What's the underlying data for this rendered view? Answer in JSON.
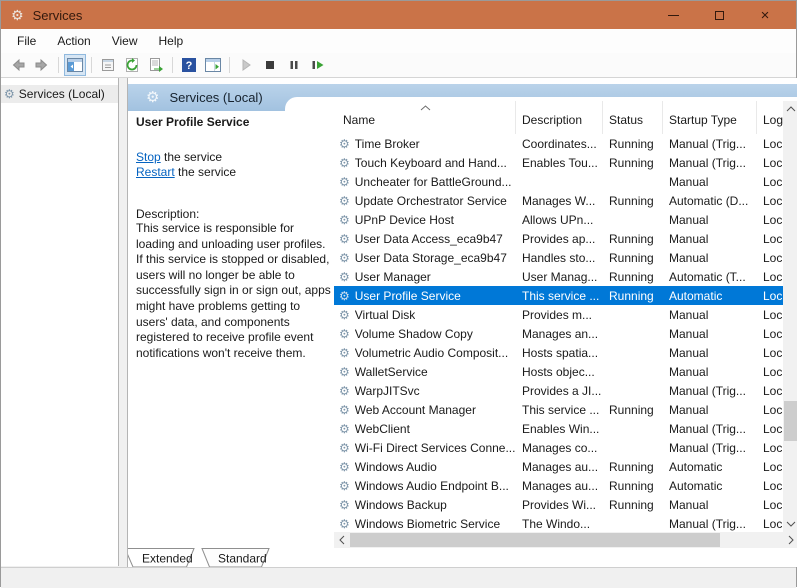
{
  "window": {
    "title": "Services"
  },
  "window_controls": {
    "minimize": "minimize",
    "maximize": "maximize",
    "close": "close"
  },
  "menu": {
    "items": [
      "File",
      "Action",
      "View",
      "Help"
    ]
  },
  "toolbar": {
    "icons": [
      "back",
      "forward",
      "show-console-tree",
      "properties",
      "refresh",
      "export-list",
      "help",
      "show-action-pane",
      "start-service",
      "stop-service",
      "pause-service",
      "restart-service"
    ]
  },
  "tree": {
    "root_label": "Services (Local)"
  },
  "detail_panel": {
    "header": "Services (Local)",
    "service_title": "User Profile Service",
    "links": [
      {
        "link": "Stop",
        "rest": " the service"
      },
      {
        "link": "Restart",
        "rest": " the service"
      }
    ],
    "description_label": "Description:",
    "description": "This service is responsible for loading and unloading user profiles. If this service is stopped or disabled, users will no longer be able to successfully sign in or sign out, apps might have problems getting to users' data, and components registered to receive profile event notifications won't receive them."
  },
  "services_list": {
    "columns": [
      "Name",
      "Description",
      "Status",
      "Startup Type",
      "Log"
    ],
    "sort_column": "Name",
    "rows": [
      {
        "name": "Time Broker",
        "description": "Coordinates...",
        "status": "Running",
        "startup_type": "Manual (Trig...",
        "log_on_as": "Loc",
        "selected": false
      },
      {
        "name": "Touch Keyboard and Hand...",
        "description": "Enables Tou...",
        "status": "Running",
        "startup_type": "Manual (Trig...",
        "log_on_as": "Loc",
        "selected": false
      },
      {
        "name": "Uncheater for BattleGround...",
        "description": "",
        "status": "",
        "startup_type": "Manual",
        "log_on_as": "Loc",
        "selected": false
      },
      {
        "name": "Update Orchestrator Service",
        "description": "Manages W...",
        "status": "Running",
        "startup_type": "Automatic (D...",
        "log_on_as": "Loc",
        "selected": false
      },
      {
        "name": "UPnP Device Host",
        "description": "Allows UPn...",
        "status": "",
        "startup_type": "Manual",
        "log_on_as": "Loc",
        "selected": false
      },
      {
        "name": "User Data Access_eca9b47",
        "description": "Provides ap...",
        "status": "Running",
        "startup_type": "Manual",
        "log_on_as": "Loc",
        "selected": false
      },
      {
        "name": "User Data Storage_eca9b47",
        "description": "Handles sto...",
        "status": "Running",
        "startup_type": "Manual",
        "log_on_as": "Loc",
        "selected": false
      },
      {
        "name": "User Manager",
        "description": "User Manag...",
        "status": "Running",
        "startup_type": "Automatic (T...",
        "log_on_as": "Loc",
        "selected": false
      },
      {
        "name": "User Profile Service",
        "description": "This service ...",
        "status": "Running",
        "startup_type": "Automatic",
        "log_on_as": "Loc",
        "selected": true
      },
      {
        "name": "Virtual Disk",
        "description": "Provides m...",
        "status": "",
        "startup_type": "Manual",
        "log_on_as": "Loc",
        "selected": false
      },
      {
        "name": "Volume Shadow Copy",
        "description": "Manages an...",
        "status": "",
        "startup_type": "Manual",
        "log_on_as": "Loc",
        "selected": false
      },
      {
        "name": "Volumetric Audio Composit...",
        "description": "Hosts spatia...",
        "status": "",
        "startup_type": "Manual",
        "log_on_as": "Loc",
        "selected": false
      },
      {
        "name": "WalletService",
        "description": "Hosts objec...",
        "status": "",
        "startup_type": "Manual",
        "log_on_as": "Loc",
        "selected": false
      },
      {
        "name": "WarpJITSvc",
        "description": "Provides a JI...",
        "status": "",
        "startup_type": "Manual (Trig...",
        "log_on_as": "Loc",
        "selected": false
      },
      {
        "name": "Web Account Manager",
        "description": "This service ...",
        "status": "Running",
        "startup_type": "Manual",
        "log_on_as": "Loc",
        "selected": false
      },
      {
        "name": "WebClient",
        "description": "Enables Win...",
        "status": "",
        "startup_type": "Manual (Trig...",
        "log_on_as": "Loc",
        "selected": false
      },
      {
        "name": "Wi-Fi Direct Services Conne...",
        "description": "Manages co...",
        "status": "",
        "startup_type": "Manual (Trig...",
        "log_on_as": "Loc",
        "selected": false
      },
      {
        "name": "Windows Audio",
        "description": "Manages au...",
        "status": "Running",
        "startup_type": "Automatic",
        "log_on_as": "Loc",
        "selected": false
      },
      {
        "name": "Windows Audio Endpoint B...",
        "description": "Manages au...",
        "status": "Running",
        "startup_type": "Automatic",
        "log_on_as": "Loc",
        "selected": false
      },
      {
        "name": "Windows Backup",
        "description": "Provides Wi...",
        "status": "Running",
        "startup_type": "Manual",
        "log_on_as": "Loc",
        "selected": false
      },
      {
        "name": "Windows Biometric Service",
        "description": "The Windo...",
        "status": "",
        "startup_type": "Manual (Trig...",
        "log_on_as": "Loc",
        "selected": false
      }
    ]
  },
  "tabs": {
    "items": [
      "Extended",
      "Standard"
    ],
    "active": "Extended"
  },
  "colors": {
    "titlebar": "#CA7348",
    "selection": "#0078D7",
    "header_band": "#A9C8E6",
    "link": "#0563C1"
  }
}
